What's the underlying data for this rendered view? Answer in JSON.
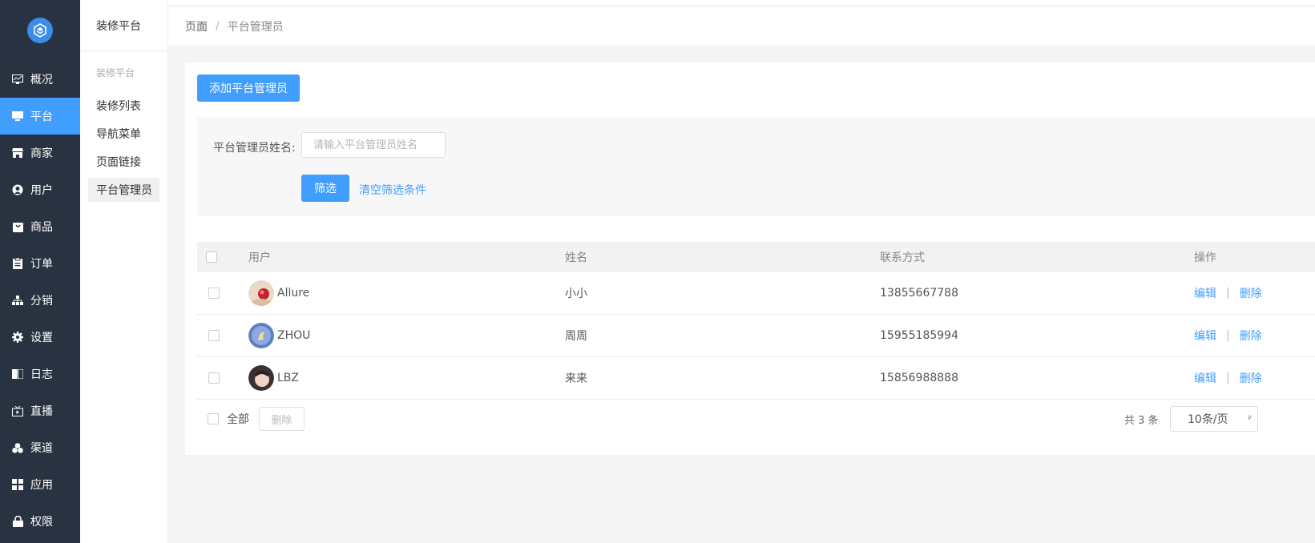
{
  "sidebar": {
    "items": [
      {
        "label": "概况",
        "icon": "chart-icon"
      },
      {
        "label": "平台",
        "icon": "monitor-icon",
        "active": true
      },
      {
        "label": "商家",
        "icon": "store-icon"
      },
      {
        "label": "用户",
        "icon": "user-icon"
      },
      {
        "label": "商品",
        "icon": "bag-icon"
      },
      {
        "label": "订单",
        "icon": "clipboard-icon"
      },
      {
        "label": "分销",
        "icon": "tree-icon"
      },
      {
        "label": "设置",
        "icon": "gear-icon"
      },
      {
        "label": "日志",
        "icon": "book-icon"
      },
      {
        "label": "直播",
        "icon": "tv-icon"
      },
      {
        "label": "渠道",
        "icon": "cluster-icon"
      },
      {
        "label": "应用",
        "icon": "grid-icon"
      },
      {
        "label": "权限",
        "icon": "lock-icon"
      }
    ]
  },
  "sub_sidebar": {
    "title": "装修平台",
    "group": "装修平台",
    "items": [
      {
        "label": "装修列表"
      },
      {
        "label": "导航菜单"
      },
      {
        "label": "页面链接"
      },
      {
        "label": "平台管理员",
        "active": true
      }
    ]
  },
  "breadcrumb": {
    "root": "页面",
    "separator": "/",
    "current": "平台管理员"
  },
  "main": {
    "add_button": "添加平台管理员",
    "filter": {
      "label": "平台管理员姓名:",
      "placeholder": "请输入平台管理员姓名",
      "value": "",
      "submit": "筛选",
      "clear": "清空筛选条件"
    },
    "table": {
      "headers": {
        "user": "用户",
        "name": "姓名",
        "contact": "联系方式",
        "ops": "操作"
      },
      "rows": [
        {
          "user": "Allure",
          "name": "小小",
          "contact": "13855667788",
          "edit": "编辑",
          "sep": "|",
          "delete": "删除"
        },
        {
          "user": "ZHOU",
          "name": "周周",
          "contact": "15955185994",
          "edit": "编辑",
          "sep": "|",
          "delete": "删除"
        },
        {
          "user": "LBZ",
          "name": "来来",
          "contact": "15856988888",
          "edit": "编辑",
          "sep": "|",
          "delete": "删除"
        }
      ]
    },
    "footer": {
      "select_all": "全部",
      "delete": "删除",
      "total": "共 3 条",
      "page_size": "10条/页"
    }
  },
  "colors": {
    "sidebar_bg": "#283241",
    "accent": "#409eff"
  }
}
